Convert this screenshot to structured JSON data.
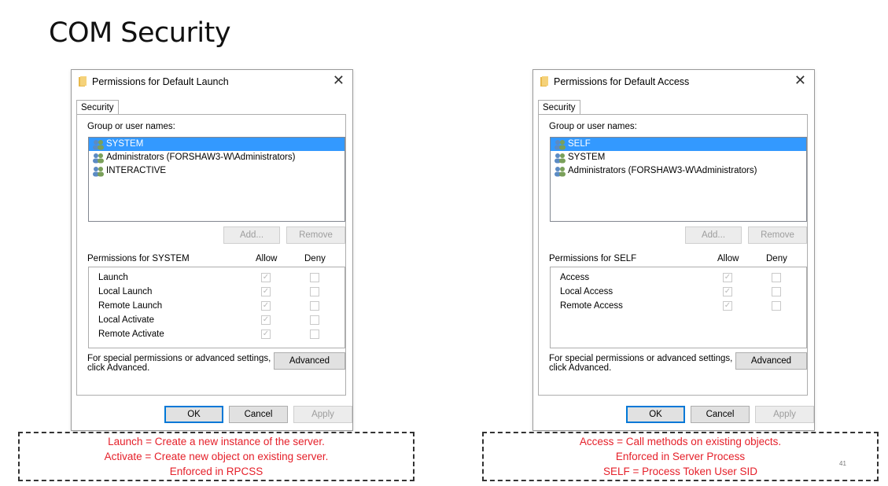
{
  "slide": {
    "title": "COM Security",
    "page_number": "41"
  },
  "dialogs": [
    {
      "title": "Permissions for Default Launch",
      "tab": "Security",
      "group_label": "Group or user names:",
      "users": [
        {
          "name": "SYSTEM",
          "selected": true
        },
        {
          "name": "Administrators (FORSHAW3-W\\Administrators)",
          "selected": false
        },
        {
          "name": "INTERACTIVE",
          "selected": false
        }
      ],
      "add_label": "Add...",
      "remove_label": "Remove",
      "permissions_label": "Permissions for SYSTEM",
      "allow_label": "Allow",
      "deny_label": "Deny",
      "permissions": [
        {
          "name": "Launch",
          "allow": true,
          "deny": false
        },
        {
          "name": "Local Launch",
          "allow": true,
          "deny": false
        },
        {
          "name": "Remote Launch",
          "allow": true,
          "deny": false
        },
        {
          "name": "Local Activate",
          "allow": true,
          "deny": false
        },
        {
          "name": "Remote Activate",
          "allow": true,
          "deny": false
        }
      ],
      "special_line1": "For special permissions or advanced settings,",
      "special_line2": "click Advanced.",
      "advanced_label": "Advanced",
      "ok_label": "OK",
      "cancel_label": "Cancel",
      "apply_label": "Apply"
    },
    {
      "title": "Permissions for Default Access",
      "tab": "Security",
      "group_label": "Group or user names:",
      "users": [
        {
          "name": "SELF",
          "selected": true
        },
        {
          "name": "SYSTEM",
          "selected": false
        },
        {
          "name": "Administrators (FORSHAW3-W\\Administrators)",
          "selected": false
        }
      ],
      "add_label": "Add...",
      "remove_label": "Remove",
      "permissions_label": "Permissions for SELF",
      "allow_label": "Allow",
      "deny_label": "Deny",
      "permissions": [
        {
          "name": "Access",
          "allow": true,
          "deny": false
        },
        {
          "name": "Local Access",
          "allow": true,
          "deny": false
        },
        {
          "name": "Remote Access",
          "allow": true,
          "deny": false
        }
      ],
      "special_line1": "For special permissions or advanced settings,",
      "special_line2": "click Advanced.",
      "advanced_label": "Advanced",
      "ok_label": "OK",
      "cancel_label": "Cancel",
      "apply_label": "Apply"
    }
  ],
  "notes": [
    {
      "lines": [
        "Launch = Create a new instance of the server.",
        "Activate = Create new object on existing server.",
        "Enforced in RPCSS"
      ]
    },
    {
      "lines": [
        "Access = Call methods on existing objects.",
        "Enforced in Server Process",
        "SELF = Process Token User SID"
      ]
    }
  ],
  "colors": {
    "selection": "#3399ff",
    "note_text": "#e5202a",
    "primary_border": "#0078d7"
  }
}
